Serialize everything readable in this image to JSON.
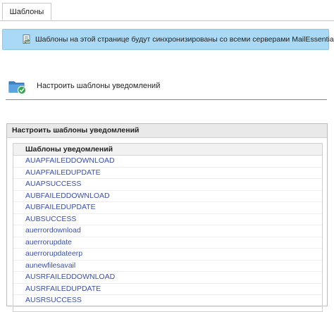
{
  "tabs": [
    {
      "label": "Шаблоны"
    }
  ],
  "banner": {
    "text": "Шаблоны на этой странице будут синхронизированы со всеми серверами MailEssentials",
    "icon": "document-sync-icon"
  },
  "section": {
    "title": "Настроить шаблоны уведомлений",
    "icon": "folder-check-icon"
  },
  "panel": {
    "title": "Настроить шаблоны уведомлений",
    "list_header": "Шаблоны уведомлений",
    "items": [
      "AUAPFAILEDDOWNLOAD",
      "AUAPFAILEDUPDATE",
      "AUAPSUCCESS",
      "AUBFAILEDDOWNLOAD",
      "AUBFAILEDUPDATE",
      "AUBSUCCESS",
      "auerrordownload",
      "auerrorupdate",
      "auerrorupdateerp",
      "aunewfilesavail",
      "AUSRFAILEDDOWNLOAD",
      "AUSRFAILEDUPDATE",
      "AUSRSUCCESS"
    ]
  },
  "colors": {
    "banner_bg": "#a9d9f5",
    "link": "#3a4fa8",
    "panel_header_bg": "#e9e9e9"
  }
}
